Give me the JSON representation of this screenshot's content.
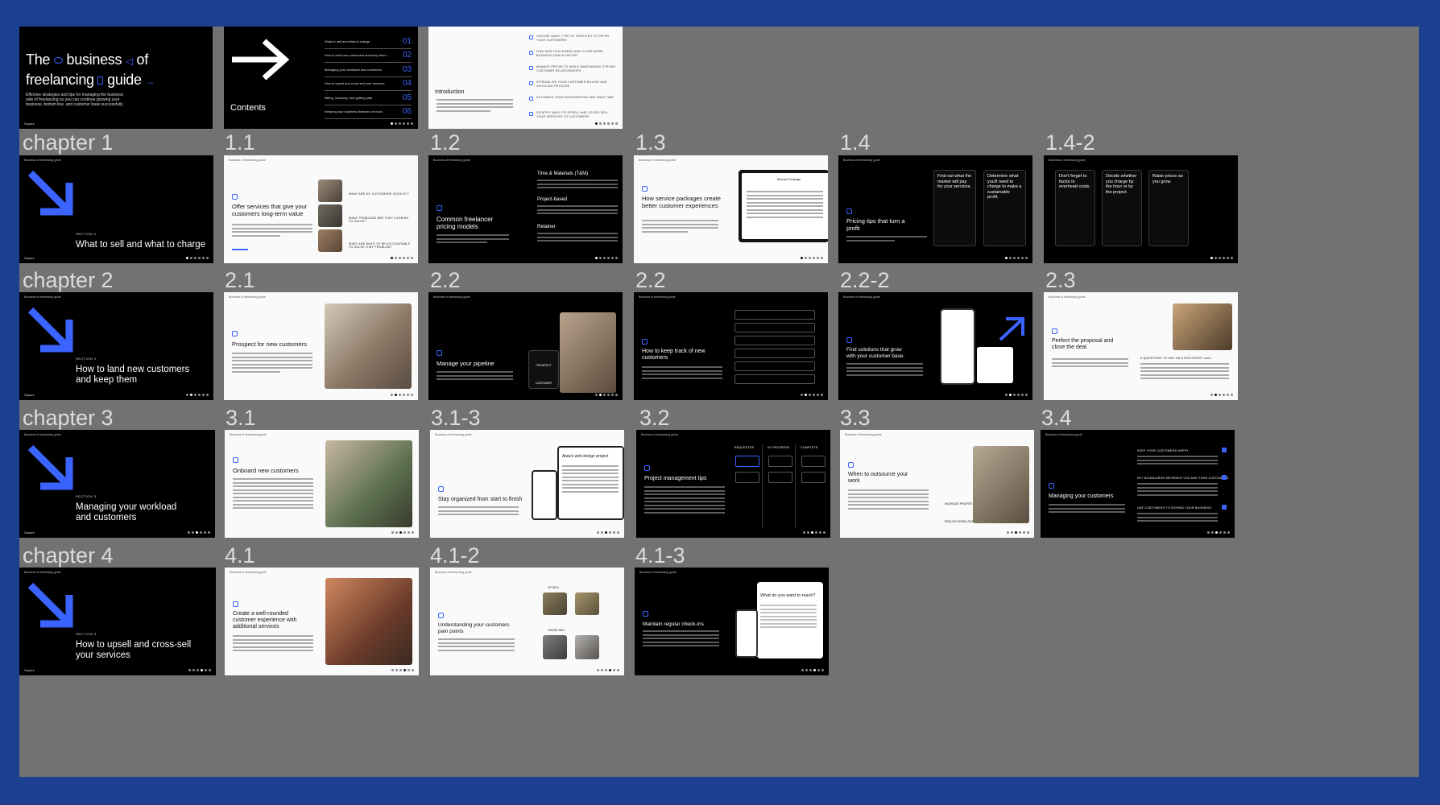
{
  "colors": {
    "frame": "#1c3f8f",
    "canvas": "#727272",
    "accent": "#3b63ff"
  },
  "row_labels": {
    "chapter1": "chapter 1",
    "chapter2": "chapter 2",
    "chapter3": "chapter 3",
    "chapter4": "chapter 4"
  },
  "slide_labels": {
    "s1_1": "1.1",
    "s1_2": "1.2",
    "s1_3": "1.3",
    "s1_4": "1.4",
    "s1_4b": "1.4-2",
    "s2_1": "2.1",
    "s2_2": "2.2",
    "s2_2b": "2.2",
    "s2_2c": "2.2-2",
    "s2_3": "2.3",
    "s3_1": "3.1",
    "s3_1b": "3.1-3",
    "s3_2": "3.2",
    "s3_3": "3.3",
    "s3_4": "3.4",
    "s4_1": "4.1",
    "s4_1b": "4.1-2",
    "s4_1c": "4.1-3"
  },
  "cover": {
    "line1": "The",
    "word1": "business",
    "word2": "of",
    "line2": "freelancing",
    "word3": "guide",
    "subtitle": "Effective strategies and tips for managing the business side of freelancing so you can continue growing your business, bottom line, and customer base successfully"
  },
  "contents": {
    "title": "Contents",
    "items": [
      {
        "text": "What to sell and what to charge",
        "num": "01"
      },
      {
        "text": "How to land new customers and keep them",
        "num": "02"
      },
      {
        "text": "Managing your workload and customers",
        "num": "03"
      },
      {
        "text": "How to upsell and cross-sell your services",
        "num": "04"
      },
      {
        "text": "Billing, invoicing, and getting paid",
        "num": "05"
      },
      {
        "text": "Keeping your business finances on track",
        "num": "06"
      }
    ]
  },
  "intro": {
    "title": "Introduction",
    "list": [
      "CHOOSE WHAT TYPE OF SERVICES TO OFFER YOUR CUSTOMERS",
      "FIND NEW CUSTOMERS AND CLOSE MORE BUSINESS DEALS FASTER",
      "MANAGE PROJECTS WHILE MAINTAINING STRONG CUSTOMER RELATIONSHIPS",
      "STREAMLINE YOUR CUSTOMER BILLING AND INVOICING PROCESS",
      "AUTOMATE YOUR BOOKKEEPING AND SAVE TIME",
      "IDENTIFY WAYS TO UPSELL AND CROSS-SELL YOUR SERVICES TO CUSTOMERS"
    ]
  },
  "sections": {
    "s1": {
      "label": "SECTION 1",
      "title": "What to sell and what to charge"
    },
    "s2": {
      "label": "SECTION 2",
      "title_a": "How to land new customers",
      "title_b": "and keep them"
    },
    "s3": {
      "label": "SECTION 3",
      "title_a": "Managing your workload",
      "title_b": "and customers"
    },
    "s4": {
      "label": "SECTION 4",
      "title_a": "How to upsell and cross-sell",
      "title_b": "your services"
    }
  },
  "ch1": {
    "s1_1": {
      "title": "Offer services that give your customers long-term value",
      "q1": "WHAT ARE MY CUSTOMERS GOOD AT?",
      "q2": "WHAT PROBLEMS ARE THEY LOOKING TO SOLVE?",
      "q3": "WHAT ARE WAYS TO BE ACCOUNTABLE TO SOLVE THAT PROBLEM?"
    },
    "s1_2": {
      "title": "Common freelancer pricing models",
      "m1": "Time & Materials (T&M)",
      "m2": "Project-based",
      "m3": "Retainer"
    },
    "s1_3": {
      "title": "How service packages create better customer experiences",
      "window": "Bronze Package"
    },
    "s1_4": {
      "title": "Pricing tips that turn a profit",
      "c1": "Find out what the market will pay for your services.",
      "c2": "Determine what you'll need to charge to make a sustainable profit."
    },
    "s1_4b": {
      "c1": "Don't forget to factor in overhead costs.",
      "c2": "Decide whether you charge by the hour or by the project.",
      "c3": "Raise prices as you grow."
    }
  },
  "ch2": {
    "s2_1": {
      "title": "Prospect for new customers"
    },
    "s2_2": {
      "title": "Manage your pipeline",
      "tag1": "PROSPECT",
      "tag2": "CUSTOMER"
    },
    "s2_2b": {
      "title": "How to keep track of new customers"
    },
    "s2_2c": {
      "title": "Find solutions that grow with your customer base."
    },
    "s2_3": {
      "title": "Perfect the proposal and close the deal",
      "q": "5 QUESTIONS TO ASK ON A DISCOVERY CALL"
    }
  },
  "ch3": {
    "s3_1": {
      "title": "Onboard new customers"
    },
    "s3_1b": {
      "title": "Stay organized from start to finish",
      "app": "Aiwa's web design project"
    },
    "s3_2": {
      "title": "Project management tips",
      "cols": [
        "REQUESTED",
        "IN PROGRESS",
        "COMPLETE"
      ]
    },
    "s3_3": {
      "title": "When to outsource your work",
      "a": "INCREASE PROFITS",
      "b": "REDUCE WORKLOAD"
    },
    "s3_4": {
      "title": "Managing your customers",
      "p1": "KEEP YOUR CUSTOMERS HAPPY",
      "p2": "SET BOUNDARIES BETWEEN YOU AND YOUR CUSTOMERS",
      "p3": "USE CUSTOMERS TO EXPAND YOUR BUSINESS"
    }
  },
  "ch4": {
    "s4_1": {
      "title": "Create a well-rounded customer experience with additional services"
    },
    "s4_1b": {
      "title": "Understanding your customers pain points",
      "a": "UP-SELL",
      "b": "CROSS-SELL"
    },
    "s4_1c": {
      "title": "Maintain regular check-ins",
      "app": "What do you want to reach?"
    }
  },
  "common": {
    "brand": "Square",
    "header": "Business of freelancing guide"
  }
}
